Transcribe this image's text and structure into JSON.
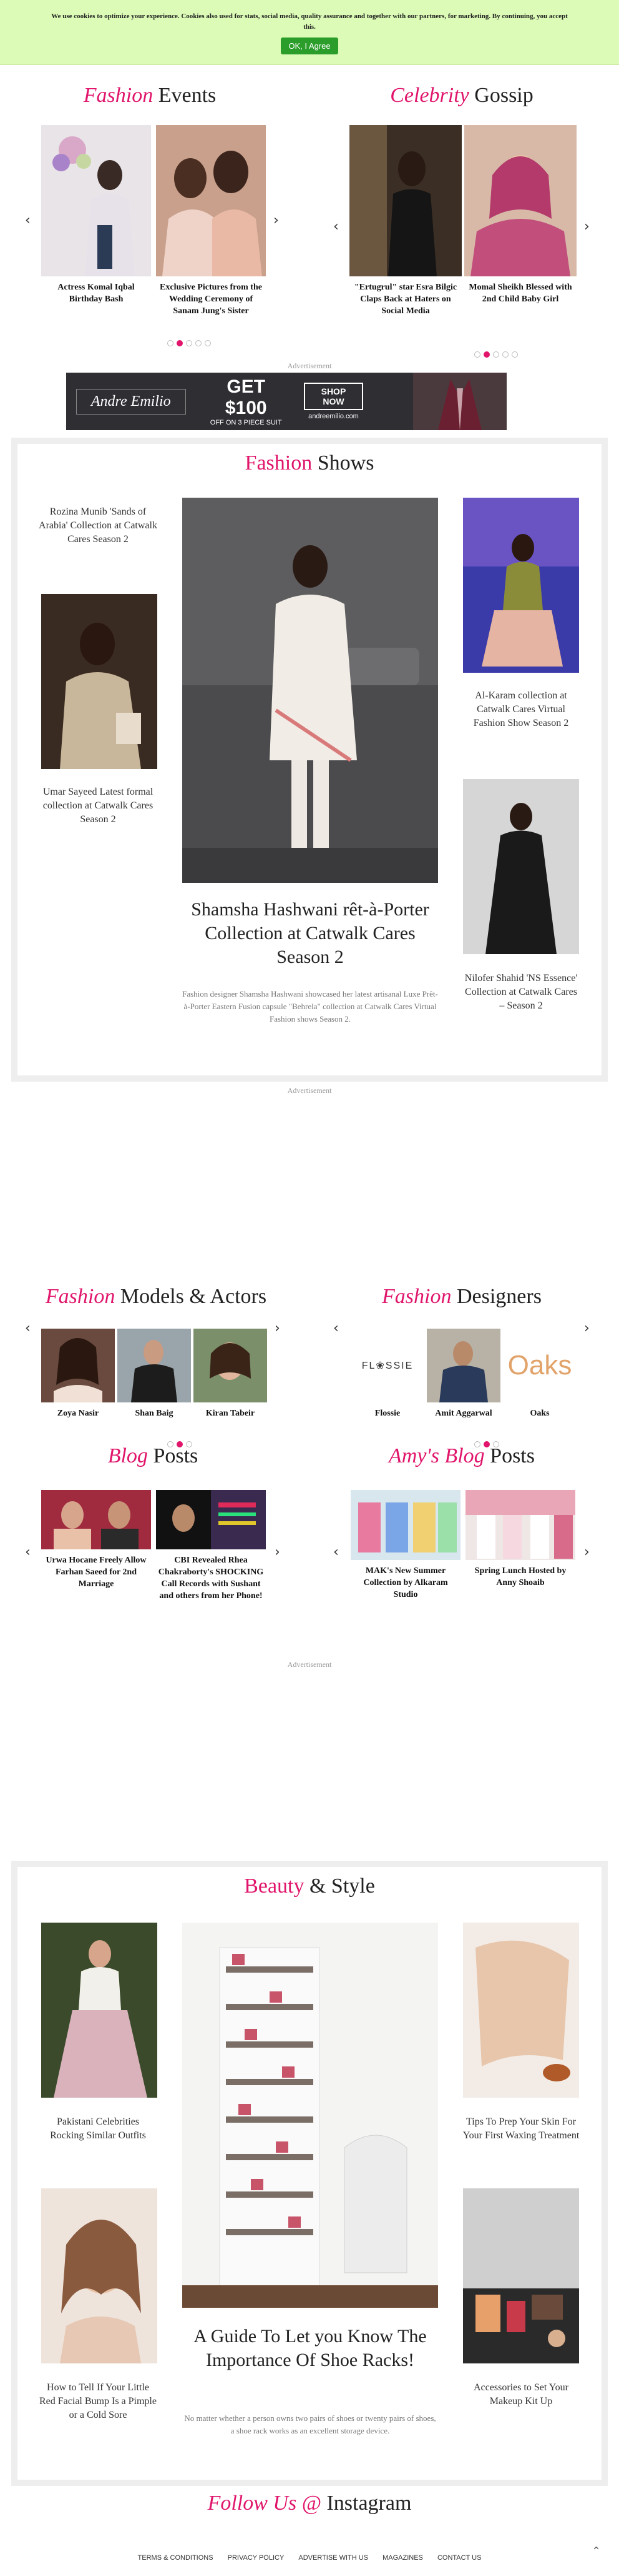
{
  "cookie": {
    "text": "We use cookies to optimize your experience. Cookies also used for stats, social media, quality assurance and together with our partners, for marketing. By continuing, you accept this.",
    "button": "OK, I Agree"
  },
  "fashion_events": {
    "title_accent": "Fashion",
    "title_rest": "Events",
    "items": [
      {
        "caption": "Actress Komal Iqbal Birthday Bash"
      },
      {
        "caption": "Exclusive Pictures from the Wedding Ceremony of Sanam Jung's Sister"
      }
    ]
  },
  "celebrity_gossip": {
    "title_accent": "Celebrity",
    "title_rest": "Gossip",
    "items": [
      {
        "caption": "\"Ertugrul\" star Esra Bilgic Claps Back at Haters on Social Media"
      },
      {
        "caption": "Momal Sheikh Blessed with 2nd Child Baby Girl"
      }
    ]
  },
  "ad1": {
    "label": "Advertisement",
    "brand": "Andre Emilio",
    "offer": "GET $100",
    "sub": "OFF ON 3 PIECE SUIT",
    "cta": "SHOP NOW",
    "url": "andreemilio.com"
  },
  "fashion_shows": {
    "title_accent": "Fashion",
    "title_rest": "Shows",
    "left_top": "Rozina Munib 'Sands of Arabia' Collection at Catwalk Cares Season 2",
    "left_bottom": "Umar Sayeed Latest formal collection at Catwalk Cares Season 2",
    "main_title": "Shamsha Hashwani rêt-à-Porter Collection at Catwalk Cares Season 2",
    "main_desc": "Fashion designer Shamsha Hashwani showcased her latest artisanal Luxe Prêt-à-Porter Eastern Fusion capsule \"Behrela\" collection at Catwalk Cares Virtual Fashion shows Season 2.",
    "right_top": "Al-Karam collection at Catwalk Cares Virtual Fashion Show Season 2",
    "right_bottom": "Nilofer Shahid 'NS Essence' Collection at Catwalk Cares – Season 2"
  },
  "ad2": {
    "label": "Advertisement"
  },
  "models": {
    "title_accent": "Fashion",
    "title_rest": "Models & Actors",
    "items": [
      {
        "name": "Zoya Nasir"
      },
      {
        "name": "Shan Baig"
      },
      {
        "name": "Kiran Tabeir"
      }
    ]
  },
  "designers": {
    "title_accent": "Fashion",
    "title_rest": "Designers",
    "items": [
      {
        "name": "Flossie",
        "logo": "FL❀SSIE"
      },
      {
        "name": "Amit Aggarwal"
      },
      {
        "name": "Oaks",
        "logo": "Oaks"
      }
    ]
  },
  "blog": {
    "title_accent": "Blog",
    "title_rest": "Posts",
    "items": [
      {
        "caption": "Urwa Hocane Freely Allow Farhan Saeed for 2nd Marriage"
      },
      {
        "caption": "CBI Revealed Rhea Chakraborty's SHOCKING Call Records with Sushant and others from her Phone!"
      }
    ]
  },
  "amys_blog": {
    "title_accent": "Amy's Blog",
    "title_rest": "Posts",
    "items": [
      {
        "caption": "MAK's New Summer Collection by Alkaram Studio"
      },
      {
        "caption": "Spring Lunch Hosted by Anny Shoaib"
      }
    ]
  },
  "ad3": {
    "label": "Advertisement"
  },
  "beauty": {
    "title_accent": "Beauty",
    "title_rest": "& Style",
    "left_top": "Pakistani Celebrities Rocking Similar Outfits",
    "left_bottom": "How to Tell If Your Little Red Facial Bump Is a Pimple or a Cold Sore",
    "main_title": "A Guide To Let you Know The Importance Of Shoe Racks!",
    "main_desc": "No matter whether a person owns two pairs of shoes or twenty pairs of shoes, a shoe rack works as an excellent storage device.",
    "right_top": "Tips To Prep Your Skin For Your First Waxing Treatment",
    "right_bottom": "Accessories to Set Your Makeup Kit Up"
  },
  "instagram": {
    "title_accent": "Follow Us @",
    "title_rest": "Instagram"
  },
  "footer": {
    "links": [
      "TERMS & CONDITIONS",
      "PRIVACY POLICY",
      "ADVERTISE WITH US",
      "MAGAZINES",
      "CONTACT US"
    ]
  },
  "colors": {
    "accent": "#e0156b",
    "cookie_bg": "#dbfbb6",
    "ok_button": "#2a9d2a"
  }
}
